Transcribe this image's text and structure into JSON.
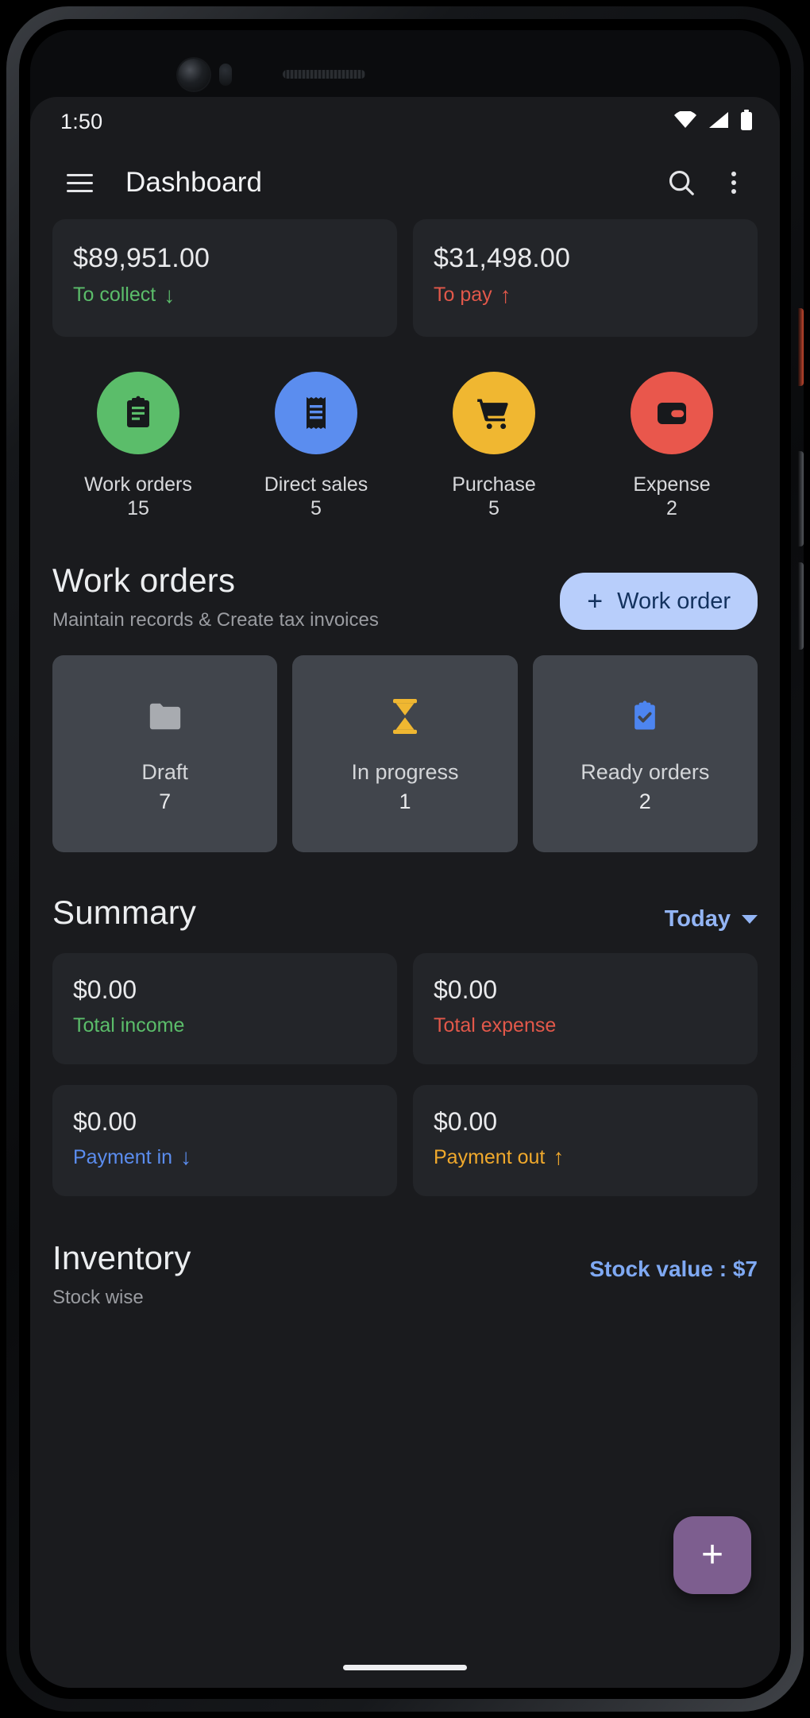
{
  "status_bar": {
    "time": "1:50",
    "icons": [
      "wifi-icon",
      "signal-icon",
      "battery-icon"
    ]
  },
  "appbar": {
    "menu_icon": "hamburger-menu-icon",
    "title": "Dashboard",
    "search_icon": "search-icon",
    "overflow_icon": "more-vertical-icon"
  },
  "money_cards": [
    {
      "amount": "$89,951.00",
      "label": "To collect",
      "arrow": "↓",
      "color": "#5bbd6a"
    },
    {
      "amount": "$31,498.00",
      "label": "To pay",
      "arrow": "↑",
      "color": "#e2584a"
    }
  ],
  "quick_actions": [
    {
      "label": "Work orders",
      "count": "15",
      "icon": "clipboard-icon",
      "color": "#5bbd6a"
    },
    {
      "label": "Direct sales",
      "count": "5",
      "icon": "receipt-icon",
      "color": "#5b8def"
    },
    {
      "label": "Purchase",
      "count": "5",
      "icon": "shopping-cart-icon",
      "color": "#f0b731"
    },
    {
      "label": "Expense",
      "count": "2",
      "icon": "wallet-icon",
      "color": "#e9574c"
    }
  ],
  "work_orders": {
    "title": "Work orders",
    "subtitle": "Maintain records & Create tax invoices",
    "button_label": "Work order",
    "button_plus": "+",
    "tiles": [
      {
        "label": "Draft",
        "count": "7",
        "icon": "folder-icon",
        "color": "#a8abb0"
      },
      {
        "label": "In progress",
        "count": "1",
        "icon": "hourglass-icon",
        "color": "#f0b731"
      },
      {
        "label": "Ready orders",
        "count": "2",
        "icon": "clipboard-check-icon",
        "color": "#4d85f0"
      }
    ]
  },
  "summary": {
    "title": "Summary",
    "period": "Today",
    "cards": [
      {
        "amount": "$0.00",
        "label": "Total income",
        "arrow": "",
        "color": "#5bbd6a"
      },
      {
        "amount": "$0.00",
        "label": "Total expense",
        "arrow": "",
        "color": "#e2584a"
      },
      {
        "amount": "$0.00",
        "label": "Payment in",
        "arrow": "↓",
        "color": "#5b8def"
      },
      {
        "amount": "$0.00",
        "label": "Payment out",
        "arrow": "↑",
        "color": "#f0a92c"
      }
    ]
  },
  "inventory": {
    "title": "Inventory",
    "subtitle": "Stock wise",
    "stock_value": "Stock value : $7"
  },
  "fab": {
    "icon": "plus-icon",
    "label": "+"
  }
}
